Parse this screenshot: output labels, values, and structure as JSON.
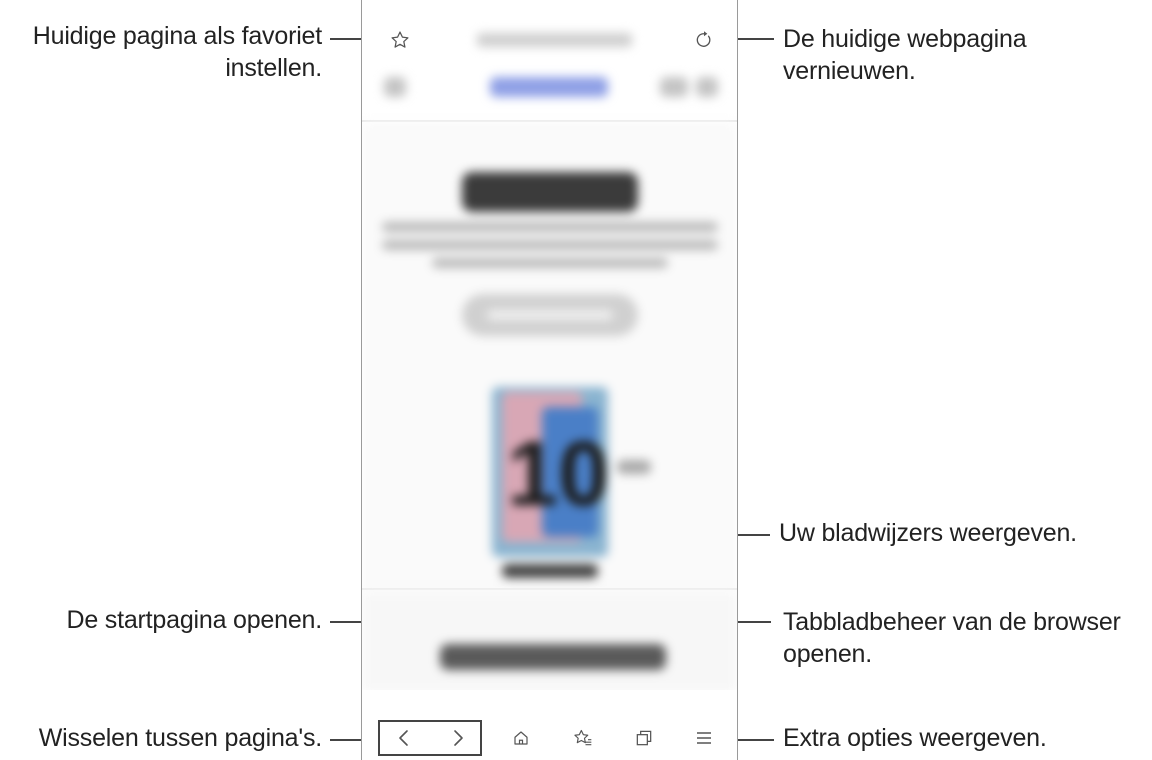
{
  "callouts": {
    "favorite": [
      "Huidige pagina als favoriet",
      "instellen."
    ],
    "refresh": [
      "De huidige webpagina",
      "vernieuwen."
    ],
    "bookmarks": "Uw bladwijzers weergeven.",
    "home": "De startpagina openen.",
    "tabs": [
      "Tabbladbeheer van de browser",
      "openen."
    ],
    "switch_pages": "Wisselen tussen pagina's.",
    "extra_options": "Extra opties weergeven."
  },
  "phone": {
    "hero_number": "10"
  },
  "colors": {
    "accent_pill": "#8fa0e6",
    "line": "#444444",
    "frame": "#9a9a9a"
  },
  "icons": {
    "top_left": "star-icon",
    "top_right": "refresh-icon",
    "nav": [
      "back-icon",
      "forward-icon",
      "home-icon",
      "bookmarks-icon",
      "tabs-icon",
      "menu-icon"
    ]
  }
}
